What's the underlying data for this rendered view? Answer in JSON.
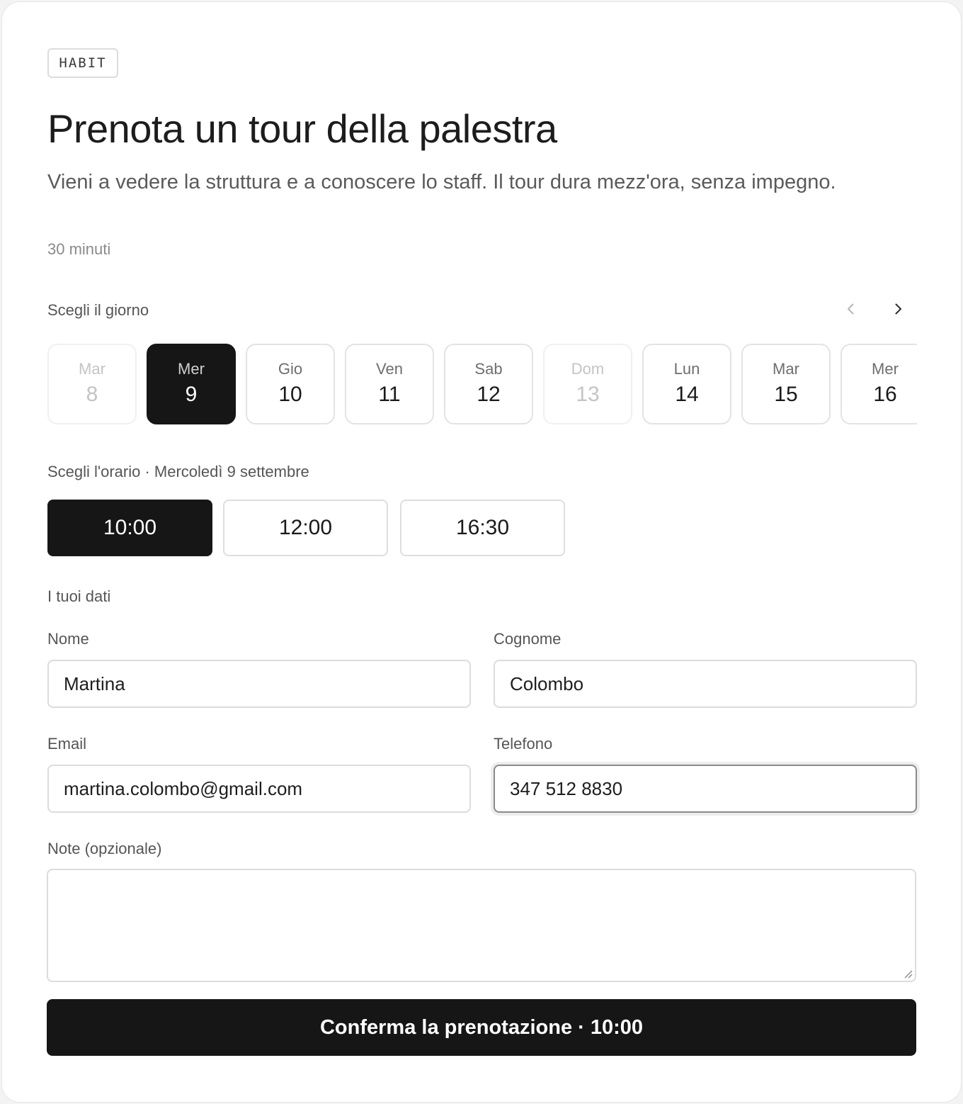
{
  "brand": "HABIT",
  "title": "Prenota un tour della palestra",
  "subtitle": "Vieni a vedere la struttura e a conoscere lo staff. Il tour dura mezz'ora, senza impegno.",
  "duration": "30 minuti",
  "day_picker": {
    "label": "Scegli il giorno",
    "prev_icon": "chevron-left-icon",
    "next_icon": "chevron-right-icon",
    "days": [
      {
        "dow": "Mar",
        "num": "8",
        "state": "disabled"
      },
      {
        "dow": "Mer",
        "num": "9",
        "state": "selected"
      },
      {
        "dow": "Gio",
        "num": "10",
        "state": "available"
      },
      {
        "dow": "Ven",
        "num": "11",
        "state": "available"
      },
      {
        "dow": "Sab",
        "num": "12",
        "state": "available"
      },
      {
        "dow": "Dom",
        "num": "13",
        "state": "disabled"
      },
      {
        "dow": "Lun",
        "num": "14",
        "state": "available"
      },
      {
        "dow": "Mar",
        "num": "15",
        "state": "available"
      },
      {
        "dow": "Mer",
        "num": "16",
        "state": "available"
      }
    ]
  },
  "time_picker": {
    "label": "Scegli l'orario · Mercoledì 9 settembre",
    "slots": [
      {
        "time": "10:00",
        "state": "selected"
      },
      {
        "time": "12:00",
        "state": "available"
      },
      {
        "time": "16:30",
        "state": "available"
      }
    ]
  },
  "form": {
    "section_label": "I tuoi dati",
    "first_name": {
      "label": "Nome",
      "value": "Martina"
    },
    "last_name": {
      "label": "Cognome",
      "value": "Colombo"
    },
    "email": {
      "label": "Email",
      "value": "martina.colombo@gmail.com"
    },
    "phone": {
      "label": "Telefono",
      "value": "347 512 8830"
    },
    "notes": {
      "label": "Note (opzionale)",
      "value": ""
    }
  },
  "submit_label": "Conferma la prenotazione · 10:00",
  "colors": {
    "primary": "#161616",
    "border": "#dcdcdc",
    "muted_text": "#5a5a5a",
    "background": "#ffffff"
  }
}
